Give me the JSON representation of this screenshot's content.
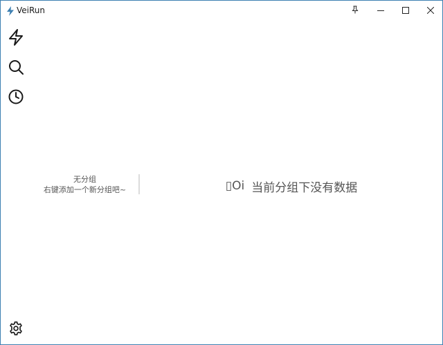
{
  "app": {
    "title": "VeiRun",
    "icon": "lightning-bolt-icon",
    "accent_color": "#3c7fb1"
  },
  "window_controls": {
    "pin": "pin-icon",
    "minimize": "minimize-icon",
    "maximize": "maximize-icon",
    "close": "close-icon"
  },
  "sidebar": {
    "items": [
      {
        "name": "run",
        "icon": "lightning-bolt-icon"
      },
      {
        "name": "search",
        "icon": "search-icon"
      },
      {
        "name": "history",
        "icon": "clock-icon"
      }
    ],
    "settings_icon": "gear-icon"
  },
  "groups": {
    "title": "无分组",
    "hint": "右键添加一个新分组吧~"
  },
  "main": {
    "empty_face": "▯Oi",
    "empty_message": "当前分组下没有数据"
  }
}
